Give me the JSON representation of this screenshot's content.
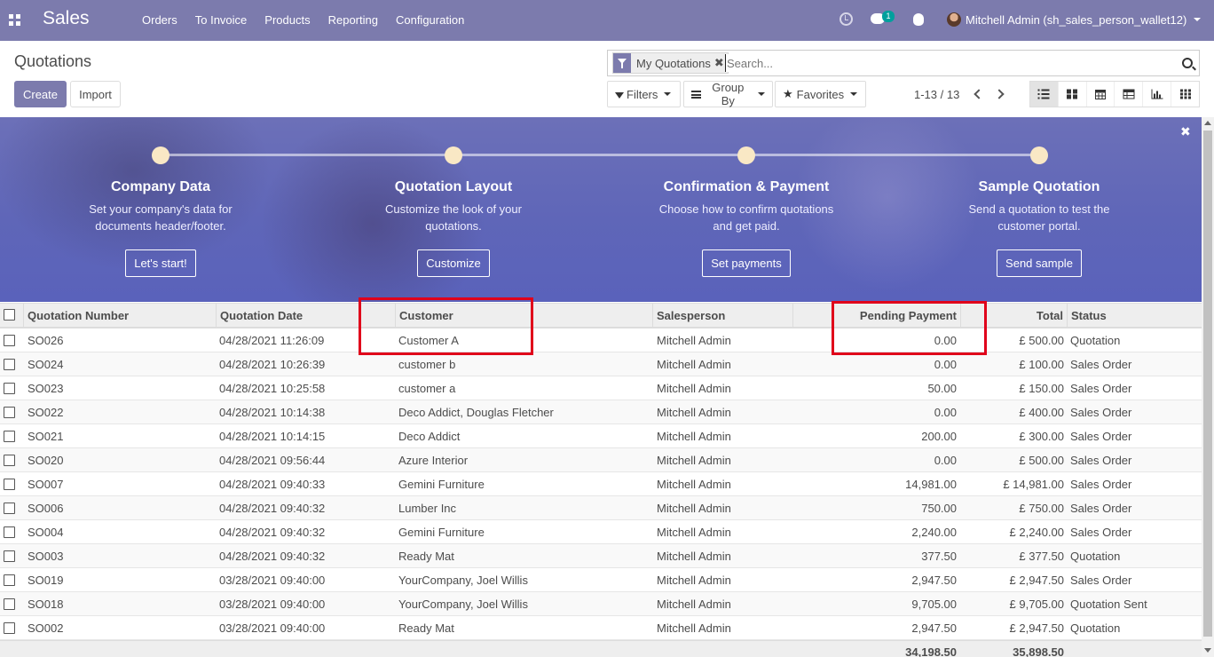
{
  "navbar": {
    "brand": "Sales",
    "menu": [
      "Orders",
      "To Invoice",
      "Products",
      "Reporting",
      "Configuration"
    ],
    "chat_badge": "1",
    "user": "Mitchell Admin (sh_sales_person_wallet12)"
  },
  "control": {
    "title": "Quotations",
    "create_label": "Create",
    "import_label": "Import",
    "facet_label": "My Quotations",
    "search_placeholder": "Search...",
    "filters_label": "Filters",
    "groupby_label": "Group By",
    "favorites_label": "Favorites",
    "pager": "1-13 / 13"
  },
  "banner": {
    "steps": [
      {
        "title": "Company Data",
        "desc": "Set your company's data for documents header/footer.",
        "button": "Let's start!"
      },
      {
        "title": "Quotation Layout",
        "desc": "Customize the look of your quotations.",
        "button": "Customize"
      },
      {
        "title": "Confirmation & Payment",
        "desc": "Choose how to confirm quotations and get paid.",
        "button": "Set payments"
      },
      {
        "title": "Sample Quotation",
        "desc": "Send a quotation to test the customer portal.",
        "button": "Send sample"
      }
    ]
  },
  "table": {
    "headers": {
      "number": "Quotation Number",
      "date": "Quotation Date",
      "customer": "Customer",
      "salesperson": "Salesperson",
      "pending": "Pending Payment",
      "total": "Total",
      "status": "Status"
    },
    "rows": [
      {
        "number": "SO026",
        "date": "04/28/2021 11:26:09",
        "customer": "Customer A",
        "salesperson": "Mitchell Admin",
        "pending": "0.00",
        "total": "£ 500.00",
        "status": "Quotation"
      },
      {
        "number": "SO024",
        "date": "04/28/2021 10:26:39",
        "customer": "customer b",
        "salesperson": "Mitchell Admin",
        "pending": "0.00",
        "total": "£ 100.00",
        "status": "Sales Order"
      },
      {
        "number": "SO023",
        "date": "04/28/2021 10:25:58",
        "customer": "customer a",
        "salesperson": "Mitchell Admin",
        "pending": "50.00",
        "total": "£ 150.00",
        "status": "Sales Order"
      },
      {
        "number": "SO022",
        "date": "04/28/2021 10:14:38",
        "customer": "Deco Addict, Douglas Fletcher",
        "salesperson": "Mitchell Admin",
        "pending": "0.00",
        "total": "£ 400.00",
        "status": "Sales Order"
      },
      {
        "number": "SO021",
        "date": "04/28/2021 10:14:15",
        "customer": "Deco Addict",
        "salesperson": "Mitchell Admin",
        "pending": "200.00",
        "total": "£ 300.00",
        "status": "Sales Order"
      },
      {
        "number": "SO020",
        "date": "04/28/2021 09:56:44",
        "customer": "Azure Interior",
        "salesperson": "Mitchell Admin",
        "pending": "0.00",
        "total": "£ 500.00",
        "status": "Sales Order"
      },
      {
        "number": "SO007",
        "date": "04/28/2021 09:40:33",
        "customer": "Gemini Furniture",
        "salesperson": "Mitchell Admin",
        "pending": "14,981.00",
        "total": "£ 14,981.00",
        "status": "Sales Order"
      },
      {
        "number": "SO006",
        "date": "04/28/2021 09:40:32",
        "customer": "Lumber Inc",
        "salesperson": "Mitchell Admin",
        "pending": "750.00",
        "total": "£ 750.00",
        "status": "Sales Order"
      },
      {
        "number": "SO004",
        "date": "04/28/2021 09:40:32",
        "customer": "Gemini Furniture",
        "salesperson": "Mitchell Admin",
        "pending": "2,240.00",
        "total": "£ 2,240.00",
        "status": "Sales Order"
      },
      {
        "number": "SO003",
        "date": "04/28/2021 09:40:32",
        "customer": "Ready Mat",
        "salesperson": "Mitchell Admin",
        "pending": "377.50",
        "total": "£ 377.50",
        "status": "Quotation"
      },
      {
        "number": "SO019",
        "date": "03/28/2021 09:40:00",
        "customer": "YourCompany, Joel Willis",
        "salesperson": "Mitchell Admin",
        "pending": "2,947.50",
        "total": "£ 2,947.50",
        "status": "Sales Order"
      },
      {
        "number": "SO018",
        "date": "03/28/2021 09:40:00",
        "customer": "YourCompany, Joel Willis",
        "salesperson": "Mitchell Admin",
        "pending": "9,705.00",
        "total": "£ 9,705.00",
        "status": "Quotation Sent"
      },
      {
        "number": "SO002",
        "date": "03/28/2021 09:40:00",
        "customer": "Ready Mat",
        "salesperson": "Mitchell Admin",
        "pending": "2,947.50",
        "total": "£ 2,947.50",
        "status": "Quotation"
      }
    ],
    "footer": {
      "pending": "34,198.50",
      "total": "35,898.50"
    }
  },
  "colors": {
    "brand": "#7c7bad",
    "highlight": "#e0001b"
  }
}
